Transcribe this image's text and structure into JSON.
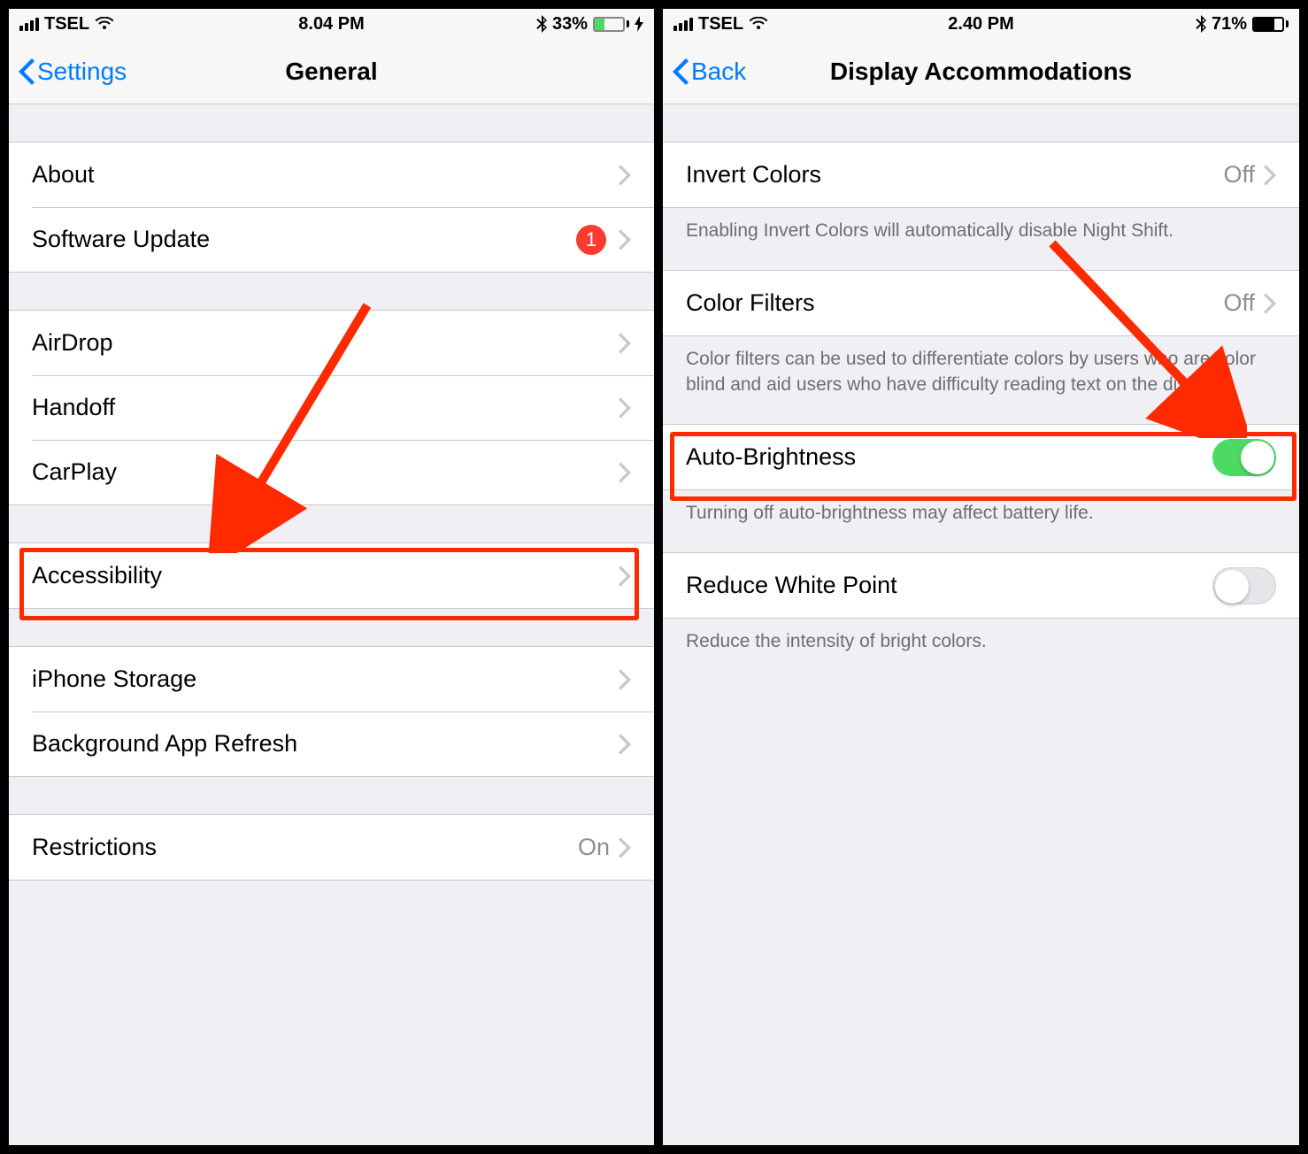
{
  "left": {
    "status": {
      "carrier": "TSEL",
      "time": "8.04 PM",
      "battery_pct": "33%",
      "battery_fill_pct": 33
    },
    "nav": {
      "back_label": "Settings",
      "title": "General"
    },
    "rows": {
      "about": "About",
      "software_update": "Software Update",
      "software_update_badge": "1",
      "airdrop": "AirDrop",
      "handoff": "Handoff",
      "carplay": "CarPlay",
      "accessibility": "Accessibility",
      "iphone_storage": "iPhone Storage",
      "background_app_refresh": "Background App Refresh",
      "restrictions": "Restrictions",
      "restrictions_value": "On"
    }
  },
  "right": {
    "status": {
      "carrier": "TSEL",
      "time": "2.40 PM",
      "battery_pct": "71%",
      "battery_fill_pct": 71
    },
    "nav": {
      "back_label": "Back",
      "title": "Display Accommodations"
    },
    "rows": {
      "invert_colors": "Invert Colors",
      "invert_colors_value": "Off",
      "invert_colors_footer": "Enabling Invert Colors will automatically disable Night Shift.",
      "color_filters": "Color Filters",
      "color_filters_value": "Off",
      "color_filters_footer": "Color filters can be used to differentiate colors by users who are color blind and aid users who have difficulty reading text on the display.",
      "auto_brightness": "Auto-Brightness",
      "auto_brightness_footer": "Turning off auto-brightness may affect battery life.",
      "reduce_white_point": "Reduce White Point",
      "reduce_white_point_footer": "Reduce the intensity of bright colors."
    }
  }
}
